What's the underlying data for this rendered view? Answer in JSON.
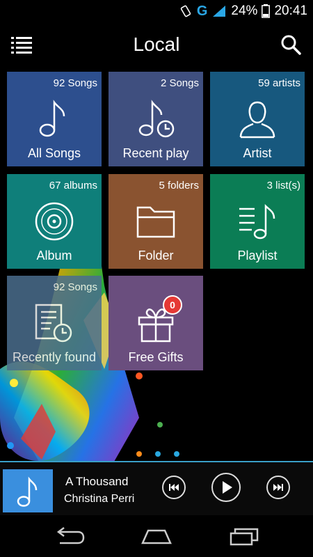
{
  "status_bar": {
    "network": "G",
    "battery": "24%",
    "time": "20:41"
  },
  "app_bar": {
    "title": "Local",
    "menu_icon": "list-menu-icon",
    "search_icon": "search-icon"
  },
  "tiles": [
    {
      "label": "All Songs",
      "count": "92 Songs",
      "color": "#2d4f8e",
      "icon": "music-note-icon"
    },
    {
      "label": "Recent play",
      "count": "2 Songs",
      "color": "#3f4f7f",
      "icon": "recent-play-icon"
    },
    {
      "label": "Artist",
      "count": "59 artists",
      "color": "#17587e",
      "icon": "person-icon"
    },
    {
      "label": "Album",
      "count": "67 albums",
      "color": "#0f7f7a",
      "icon": "disc-icon"
    },
    {
      "label": "Folder",
      "count": "5 folders",
      "color": "#8a5330",
      "icon": "folder-icon"
    },
    {
      "label": "Playlist",
      "count": "3 list(s)",
      "color": "#0b7d55",
      "icon": "playlist-icon"
    },
    {
      "label": "Recently found",
      "count": "92 Songs",
      "color": "#4a6e8e",
      "icon": "recently-found-icon"
    },
    {
      "label": "Free Gifts",
      "count": "",
      "color": "#6a4e7e",
      "icon": "gift-icon",
      "badge": "0"
    }
  ],
  "page_dots": [
    {
      "color": "#ff8c1a",
      "active": true
    },
    {
      "color": "#29a8e0",
      "active": false
    },
    {
      "color": "#29a8e0",
      "active": false
    }
  ],
  "now_playing": {
    "title": "A Thousand",
    "artist": "Christina Perri",
    "cover_icon": "music-note-icon",
    "controls": [
      "previous-icon",
      "play-icon",
      "next-icon"
    ]
  },
  "nav_bar": {
    "buttons": [
      "back-icon",
      "home-icon",
      "recents-icon"
    ]
  }
}
